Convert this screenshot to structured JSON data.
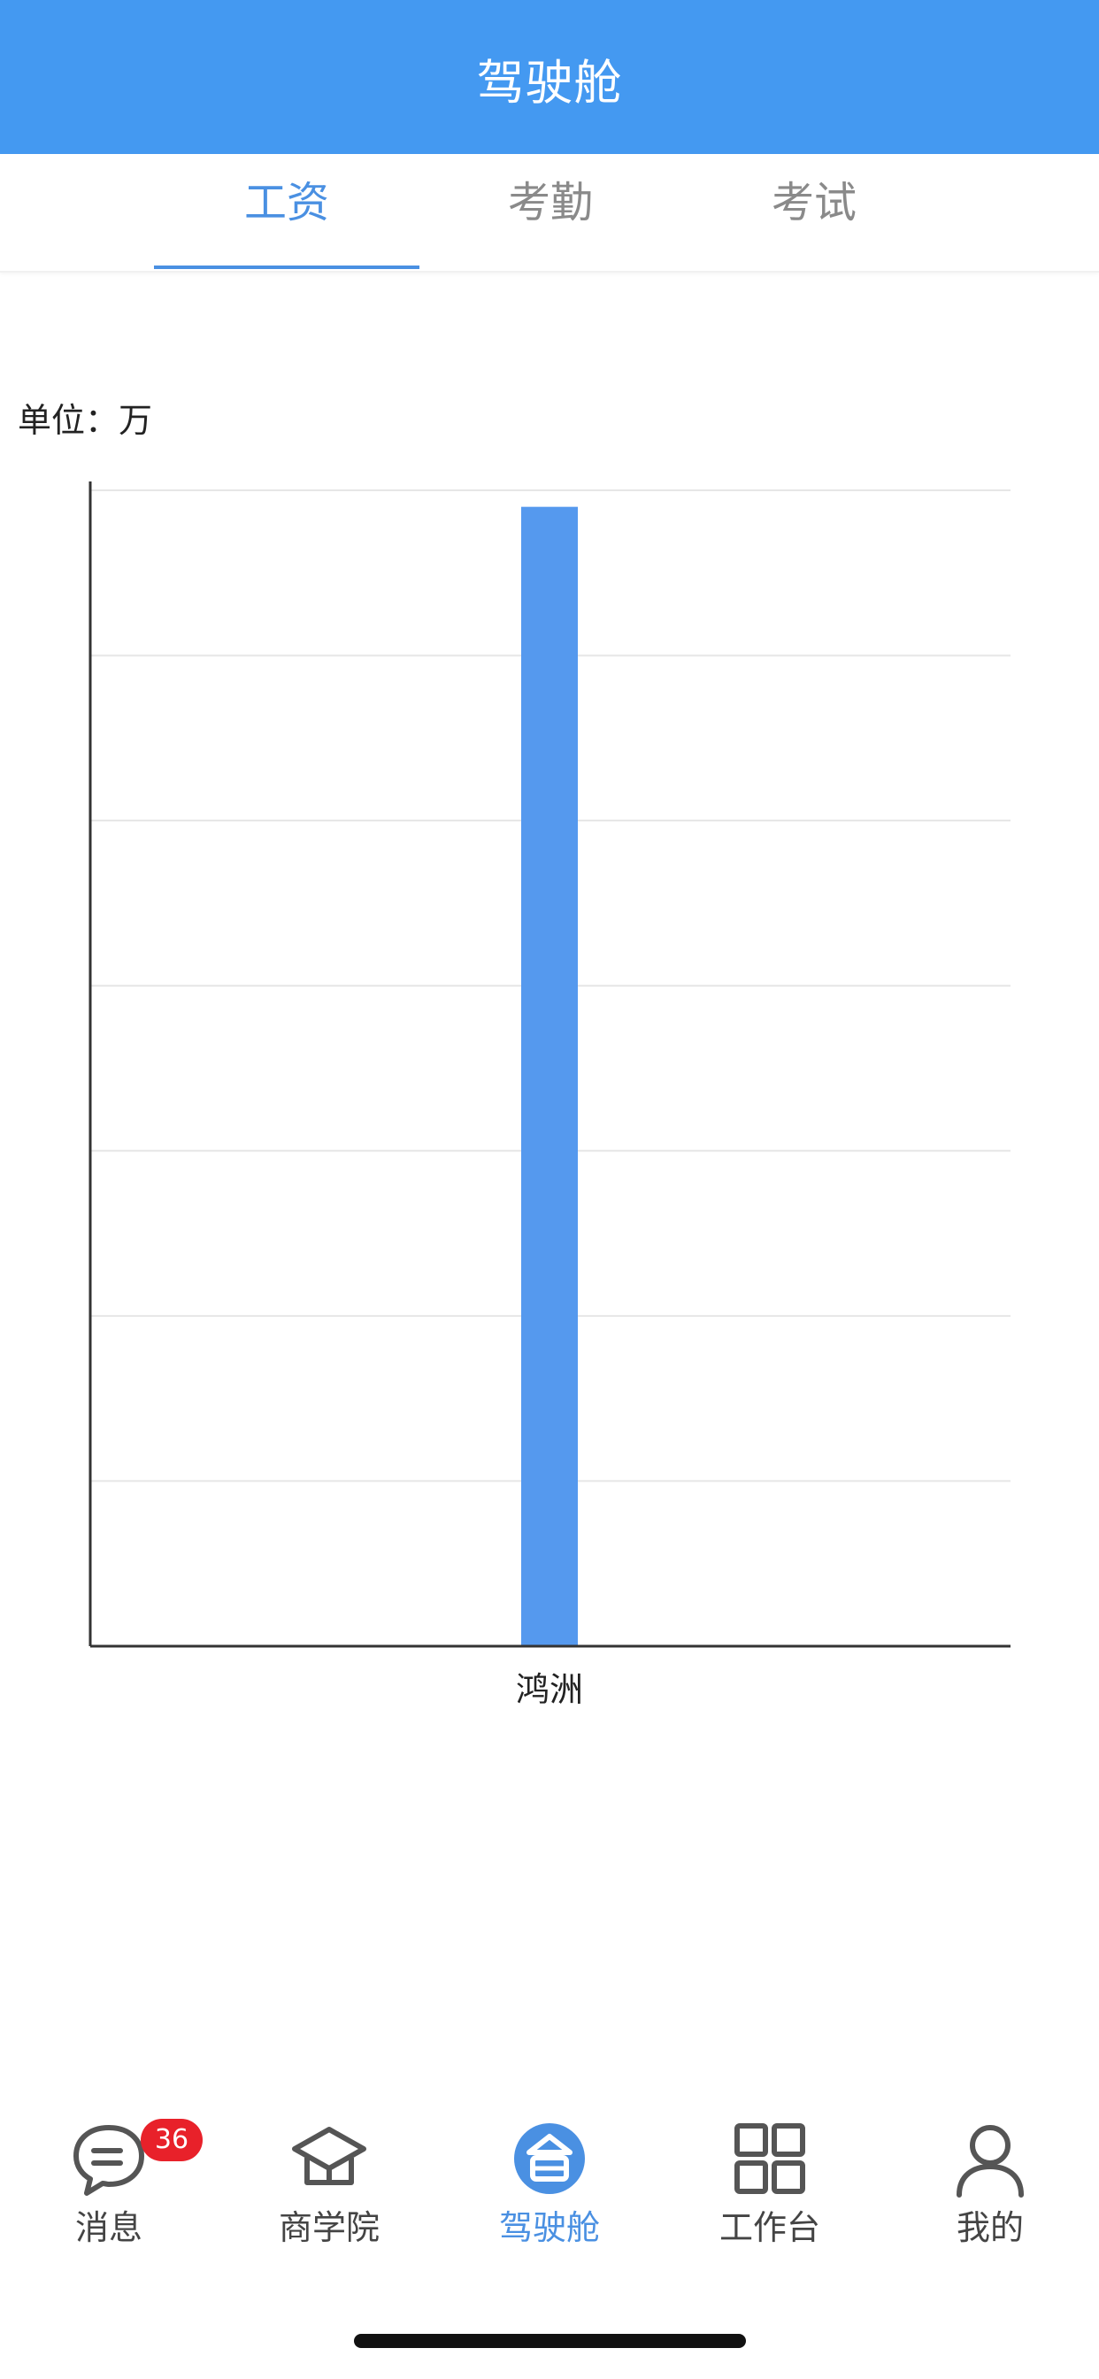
{
  "header": {
    "title": "驾驶舱"
  },
  "tabs": [
    {
      "label": "工资",
      "active": true
    },
    {
      "label": "考勤",
      "active": false
    },
    {
      "label": "考试",
      "active": false
    }
  ],
  "unit_label": "单位：万",
  "chart_data": {
    "type": "bar",
    "categories": [
      "鸿洲"
    ],
    "values": [
      6.9
    ],
    "title": "",
    "xlabel": "",
    "ylabel": "",
    "ylim": [
      0,
      7
    ],
    "y_gridline_count": 7,
    "y_tick_labels_shown": false,
    "grid": true,
    "bar_color": "#5599ee"
  },
  "bottom_nav": {
    "items": [
      {
        "label": "消息",
        "icon": "message-icon",
        "badge": "36",
        "active": false
      },
      {
        "label": "商学院",
        "icon": "graduation-cap-icon",
        "active": false
      },
      {
        "label": "驾驶舱",
        "icon": "cockpit-icon",
        "active": true
      },
      {
        "label": "工作台",
        "icon": "grid-icon",
        "active": false
      },
      {
        "label": "我的",
        "icon": "person-icon",
        "active": false
      }
    ]
  },
  "colors": {
    "header_bg": "#4499f1",
    "accent": "#4a90e2",
    "badge": "#e8212a",
    "inactive_text": "#8a8a8a"
  }
}
